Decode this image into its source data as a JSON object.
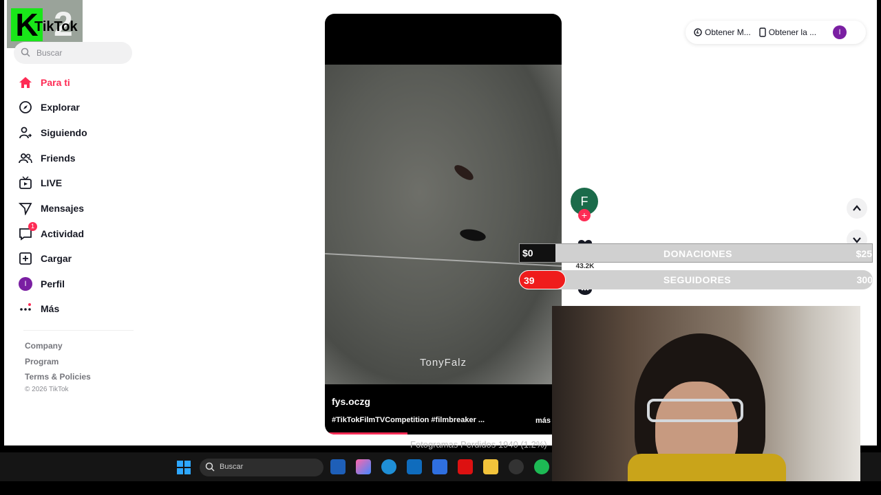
{
  "logo": {
    "k": "K",
    "two": "2",
    "tiktok": "TikTok"
  },
  "search": {
    "placeholder": "Buscar"
  },
  "nav": {
    "items": [
      {
        "label": "Para ti",
        "icon": "home-icon"
      },
      {
        "label": "Explorar",
        "icon": "compass-icon"
      },
      {
        "label": "Siguiendo",
        "icon": "following-icon"
      },
      {
        "label": "Friends",
        "icon": "friends-icon"
      },
      {
        "label": "LIVE",
        "icon": "live-icon"
      },
      {
        "label": "Mensajes",
        "icon": "send-icon"
      },
      {
        "label": "Actividad",
        "icon": "activity-icon",
        "badge": "1"
      },
      {
        "label": "Cargar",
        "icon": "upload-icon"
      },
      {
        "label": "Perfil",
        "icon": "profile-avatar"
      },
      {
        "label": "Más",
        "icon": "more-icon"
      }
    ]
  },
  "footer": {
    "company": "Company",
    "program": "Program",
    "terms": "Terms & Policies",
    "copyright": "© 2026 TikTok"
  },
  "topbar": {
    "get_m": "Obtener M...",
    "get_app": "Obtener la ...",
    "avatar": "I"
  },
  "video": {
    "watermark": "TonyFalz",
    "username": "fys.oczg",
    "caption": "#TikTokFilmTVCompetition #filmbreaker ...",
    "more": "más"
  },
  "actions": {
    "author_initial": "F",
    "plus": "+",
    "likes": "43.2K"
  },
  "overlay": {
    "donations": {
      "current": "$0",
      "label": "DONACIONES",
      "goal": "$25"
    },
    "followers": {
      "current": "39",
      "label": "SEGUIDORES",
      "goal": "300"
    }
  },
  "taskbar": {
    "search": "Buscar",
    "subtitle": "Fotogramas Perdidos 1940 (1.2%)"
  },
  "colors": {
    "accent": "#fe2c55",
    "green_logo": "#19e619"
  }
}
